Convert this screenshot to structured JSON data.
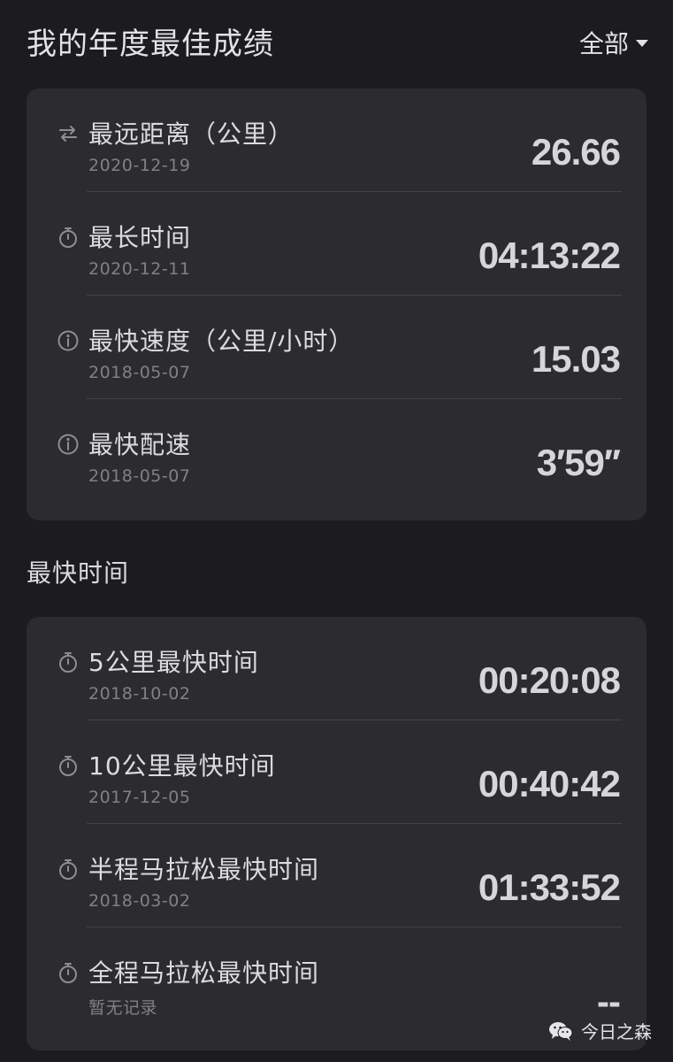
{
  "header": {
    "title": "我的年度最佳成绩",
    "filter_label": "全部"
  },
  "best_records": [
    {
      "icon": "route-arrows-icon",
      "label": "最远距离（公里）",
      "date": "2020-12-19",
      "value": "26.66"
    },
    {
      "icon": "stopwatch-icon",
      "label": "最长时间",
      "date": "2020-12-11",
      "value": "04:13:22"
    },
    {
      "icon": "info-circle-icon",
      "label": "最快速度（公里/小时）",
      "date": "2018-05-07",
      "value": "15.03"
    },
    {
      "icon": "info-circle-icon",
      "label": "最快配速",
      "date": "2018-05-07",
      "value": "3′59′′"
    }
  ],
  "fastest_section": {
    "title": "最快时间",
    "records": [
      {
        "icon": "stopwatch-icon",
        "label": "5公里最快时间",
        "date": "2018-10-02",
        "value": "00:20:08"
      },
      {
        "icon": "stopwatch-icon",
        "label": "10公里最快时间",
        "date": "2017-12-05",
        "value": "00:40:42"
      },
      {
        "icon": "stopwatch-icon",
        "label": "半程马拉松最快时间",
        "date": "2018-03-02",
        "value": "01:33:52"
      },
      {
        "icon": "stopwatch-icon",
        "label": "全程马拉松最快时间",
        "date": "暂无记录",
        "value": "--"
      }
    ]
  },
  "watermark": {
    "text": "今日之森",
    "icon": "wechat-icon"
  },
  "colors": {
    "background": "#1c1c1e",
    "card": "#2c2c2f",
    "text_primary": "#dcdcde",
    "text_secondary": "#808086"
  }
}
